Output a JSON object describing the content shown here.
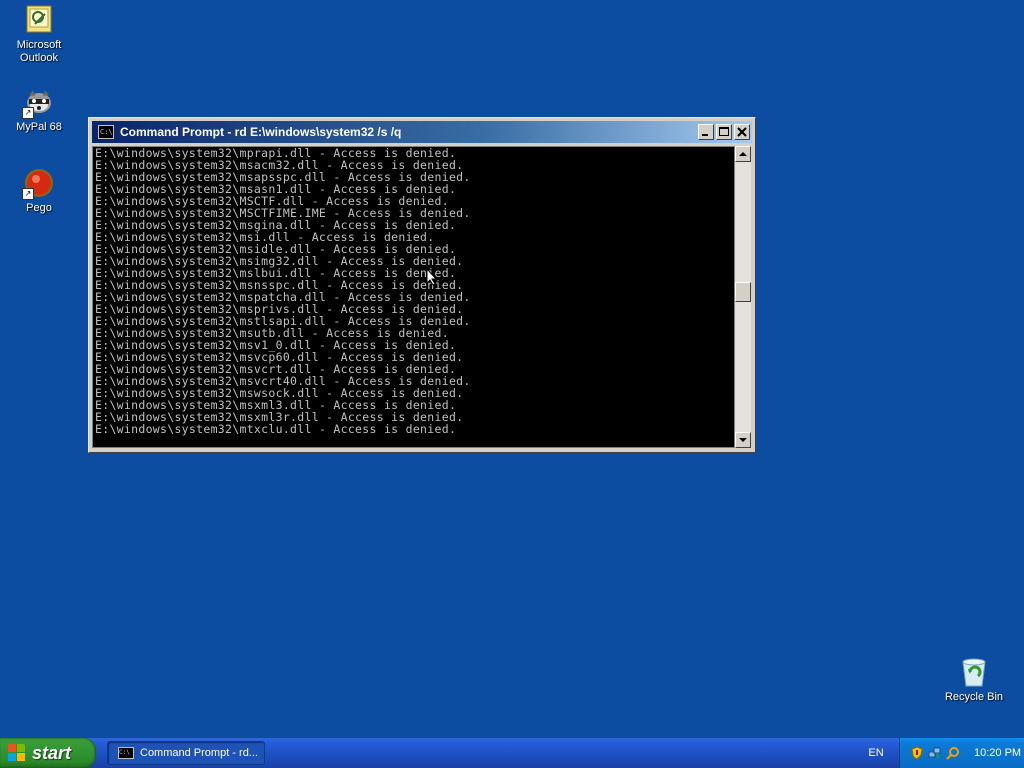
{
  "desktop": {
    "icons": [
      {
        "label": "Microsoft\nOutlook"
      },
      {
        "label": "MyPal 68"
      },
      {
        "label": "Pego"
      },
      {
        "label": "Recycle Bin"
      }
    ]
  },
  "window": {
    "title": "Command Prompt - rd E:\\windows\\system32 /s /q",
    "title_icon_text": "C:\\",
    "lines": [
      "E:\\windows\\system32\\mprapi.dll - Access is denied.",
      "E:\\windows\\system32\\msacm32.dll - Access is denied.",
      "E:\\windows\\system32\\msapsspc.dll - Access is denied.",
      "E:\\windows\\system32\\msasn1.dll - Access is denied.",
      "E:\\windows\\system32\\MSCTF.dll - Access is denied.",
      "E:\\windows\\system32\\MSCTFIME.IME - Access is denied.",
      "E:\\windows\\system32\\msgina.dll - Access is denied.",
      "E:\\windows\\system32\\msi.dll - Access is denied.",
      "E:\\windows\\system32\\msidle.dll - Access is denied.",
      "E:\\windows\\system32\\msimg32.dll - Access is denied.",
      "E:\\windows\\system32\\mslbui.dll - Access is denied.",
      "E:\\windows\\system32\\msnsspc.dll - Access is denied.",
      "E:\\windows\\system32\\mspatcha.dll - Access is denied.",
      "E:\\windows\\system32\\msprivs.dll - Access is denied.",
      "E:\\windows\\system32\\mstlsapi.dll - Access is denied.",
      "E:\\windows\\system32\\msutb.dll - Access is denied.",
      "E:\\windows\\system32\\msv1_0.dll - Access is denied.",
      "E:\\windows\\system32\\msvcp60.dll - Access is denied.",
      "E:\\windows\\system32\\msvcrt.dll - Access is denied.",
      "E:\\windows\\system32\\msvcrt40.dll - Access is denied.",
      "E:\\windows\\system32\\mswsock.dll - Access is denied.",
      "E:\\windows\\system32\\msxml3.dll - Access is denied.",
      "E:\\windows\\system32\\msxml3r.dll - Access is denied.",
      "E:\\windows\\system32\\mtxclu.dll - Access is denied."
    ]
  },
  "taskbar": {
    "start_label": "start",
    "task_label": "Command Prompt - rd...",
    "language": "EN",
    "clock": "10:20 PM"
  },
  "colors": {
    "desktop": "#0c4da2",
    "console_bg": "#000000",
    "console_text": "#c0c0c0",
    "start_green": "#379a37"
  },
  "icons": {
    "outlook": "outlook-icon",
    "mypal": "mypal-icon",
    "pego": "pego-icon",
    "recycle": "recycle-bin-icon",
    "cmd": "command-prompt-icon"
  }
}
